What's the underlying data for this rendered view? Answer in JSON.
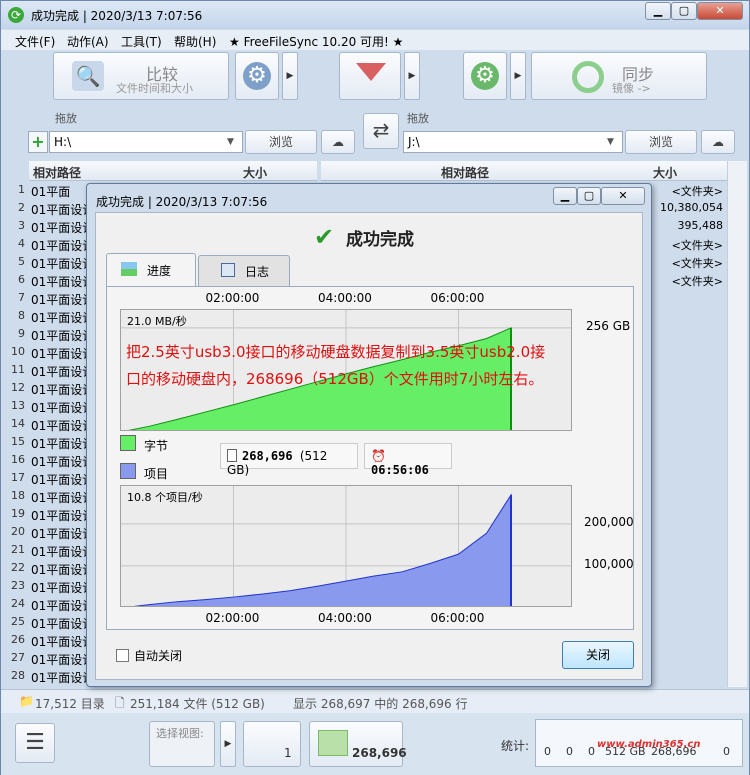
{
  "window": {
    "title": "成功完成 | 2020/3/13 7:07:56"
  },
  "menu": {
    "file": "文件(F)",
    "action": "动作(A)",
    "tools": "工具(T)",
    "help": "帮助(H)",
    "promo": "★ FreeFileSync 10.20 可用! ★"
  },
  "toolbar": {
    "compare_label": "比较",
    "compare_sub": "文件时间和大小",
    "sync_label": "同步",
    "sync_sub": "镜像 ->"
  },
  "left_folder": {
    "drop_label": "拖放",
    "path": "H:\\",
    "browse_label": "浏览"
  },
  "right_folder": {
    "drop_label": "拖放",
    "path": "J:\\",
    "browse_label": "浏览"
  },
  "grid": {
    "left_header_path": "相对路径",
    "left_header_size": "大小",
    "right_header_path": "相对路径",
    "right_header_size": "大小",
    "rows": [
      {
        "num": "1",
        "left": "01平面",
        "right_size": "<文件夹>"
      },
      {
        "num": "2",
        "left": "01平面设计",
        "right_size": "10,380,054"
      },
      {
        "num": "3",
        "left": "01平面设计",
        "right_size": "395,488"
      },
      {
        "num": "4",
        "left": "01平面设计",
        "right_size": "<文件夹>"
      },
      {
        "num": "5",
        "left": "01平面设计",
        "right_size": "<文件夹>"
      },
      {
        "num": "6",
        "left": "01平面设计",
        "right_size": "<文件夹>"
      },
      {
        "num": "7",
        "left": "01平面设计",
        "right_size": ""
      },
      {
        "num": "8",
        "left": "01平面设计",
        "right_size": ""
      },
      {
        "num": "9",
        "left": "01平面设计",
        "right_size": ""
      },
      {
        "num": "10",
        "left": "01平面设计",
        "right_size": ""
      },
      {
        "num": "11",
        "left": "01平面设计",
        "right_size": ""
      },
      {
        "num": "12",
        "left": "01平面设计",
        "right_size": ""
      },
      {
        "num": "13",
        "left": "01平面设计",
        "right_size": ""
      },
      {
        "num": "14",
        "left": "01平面设计",
        "right_size": ""
      },
      {
        "num": "15",
        "left": "01平面设计",
        "right_size": ""
      },
      {
        "num": "16",
        "left": "01平面设计",
        "right_size": ""
      },
      {
        "num": "17",
        "left": "01平面设计",
        "right_size": ""
      },
      {
        "num": "18",
        "left": "01平面设计",
        "right_size": ""
      },
      {
        "num": "19",
        "left": "01平面设计",
        "right_size": ""
      },
      {
        "num": "20",
        "left": "01平面设计",
        "right_size": ""
      },
      {
        "num": "21",
        "left": "01平面设计",
        "right_size": ""
      },
      {
        "num": "22",
        "left": "01平面设计",
        "right_size": ""
      },
      {
        "num": "23",
        "left": "01平面设计",
        "right_size": ""
      },
      {
        "num": "24",
        "left": "01平面设计",
        "right_size": ""
      },
      {
        "num": "25",
        "left": "01平面设计",
        "right_size": ""
      },
      {
        "num": "26",
        "left": "01平面设计",
        "right_size": ""
      },
      {
        "num": "27",
        "left": "01平面设计",
        "right_size": ""
      },
      {
        "num": "28",
        "left": "01平面设计",
        "right_size": ""
      }
    ]
  },
  "dialog": {
    "title": "成功完成 | 2020/3/13 7:07:56",
    "heading": "成功完成",
    "tab_progress": "进度",
    "tab_log": "日志",
    "legend_bytes": "字节",
    "legend_items": "项目",
    "items_count": "268,696",
    "items_size": "(512 GB)",
    "elapsed": "06:56:06",
    "auto_close_label": "自动关闭",
    "close_button": "关闭",
    "annotation": "把2.5英寸usb3.0接口的移动硬盘数据复制到3.5英寸usb2.0接口的移动硬盘内，268696（512GB）个文件用时7小时左右。"
  },
  "status": {
    "dirs": "17,512 目录",
    "files": "251,184 文件 (512 GB)",
    "shown": "显示 268,697 中的 268,696 行"
  },
  "bottom": {
    "view_label": "选择视图:",
    "count1": "1",
    "count_sync": "268,696",
    "stats_label": "统计:",
    "stats_values": [
      "0",
      "0",
      "0",
      "512 GB",
      "268,696",
      "0"
    ],
    "watermark": "www.admin365.cn"
  },
  "colors": {
    "bytes_fill": "#66ee66",
    "bytes_line": "#109010",
    "items_fill": "#8899ee",
    "items_line": "#2233cc",
    "annotation": "#e01010"
  },
  "chart_data": [
    {
      "type": "area",
      "title": "21.0 MB/秒",
      "series": [
        {
          "name": "字节",
          "x": [
            "00:00",
            "00:30",
            "01:00",
            "01:30",
            "02:00",
            "02:30",
            "03:00",
            "03:30",
            "04:00",
            "04:30",
            "05:00",
            "05:30",
            "06:00",
            "06:30",
            "06:56"
          ],
          "values_gb": [
            0,
            14,
            31,
            49,
            67,
            86,
            105,
            124,
            143,
            161,
            178,
            196,
            212,
            230,
            256
          ]
        }
      ],
      "x_ticks": [
        "02:00:00",
        "04:00:00",
        "06:00:00"
      ],
      "y_ticks": [
        "256 GB"
      ],
      "ylim_gb": [
        0,
        300
      ]
    },
    {
      "type": "area",
      "title": "10.8 个项目/秒",
      "series": [
        {
          "name": "项目",
          "x": [
            "00:00",
            "00:30",
            "01:00",
            "01:30",
            "02:00",
            "02:30",
            "03:00",
            "03:30",
            "04:00",
            "04:30",
            "05:00",
            "05:30",
            "06:00",
            "06:30",
            "06:56"
          ],
          "values": [
            0,
            8000,
            15000,
            20000,
            26000,
            33000,
            41000,
            52000,
            64000,
            76000,
            86000,
            106000,
            128000,
            178000,
            268696
          ]
        }
      ],
      "x_ticks": [
        "02:00:00",
        "04:00:00",
        "06:00:00"
      ],
      "y_ticks": [
        "100,000",
        "200,000"
      ],
      "ylim": [
        0,
        290000
      ]
    }
  ]
}
